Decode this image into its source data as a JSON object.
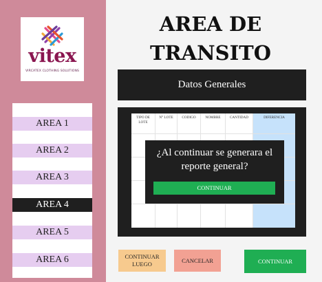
{
  "logo": {
    "brand": "vitex",
    "tagline": "VIRCATEX CLOTHING SOLUTIONS",
    "colors": [
      "#e24b8c",
      "#f2a93b",
      "#8e3fa8",
      "#2b9ad6",
      "#e8532e",
      "#6b3d9a"
    ]
  },
  "sidebar": {
    "items": [
      {
        "label": "AREA 1",
        "active": false
      },
      {
        "label": "AREA 2",
        "active": false
      },
      {
        "label": "AREA 3",
        "active": false
      },
      {
        "label": "AREA 4",
        "active": true
      },
      {
        "label": "AREA 5",
        "active": false
      },
      {
        "label": "AREA 6",
        "active": false
      }
    ]
  },
  "header": {
    "title": "AREA DE TRANSITO"
  },
  "datos": {
    "label": "Datos Generales"
  },
  "table": {
    "columns": [
      "TIPO DE LOTE",
      "N° LOTE",
      "CODIGO",
      "NOMBRE",
      "CANTIDAD",
      "DIFERENCIA"
    ]
  },
  "dialog": {
    "message": "¿Al continuar se generara el reporte general?",
    "confirm_label": "CONTINUAR"
  },
  "actions": {
    "later_label": "CONTINUAR LUEGO",
    "cancel_label": "CANCELAR",
    "continue_label": "CONTINUAR"
  },
  "theme": {
    "sidebar_bg": "#cf8a9a",
    "dark": "#1f1f1f",
    "green": "#1fae53",
    "orange": "#f7ca8e",
    "salmon": "#f2a193",
    "lavender": "#e6cdf0",
    "light_blue": "#c6e2fb"
  }
}
